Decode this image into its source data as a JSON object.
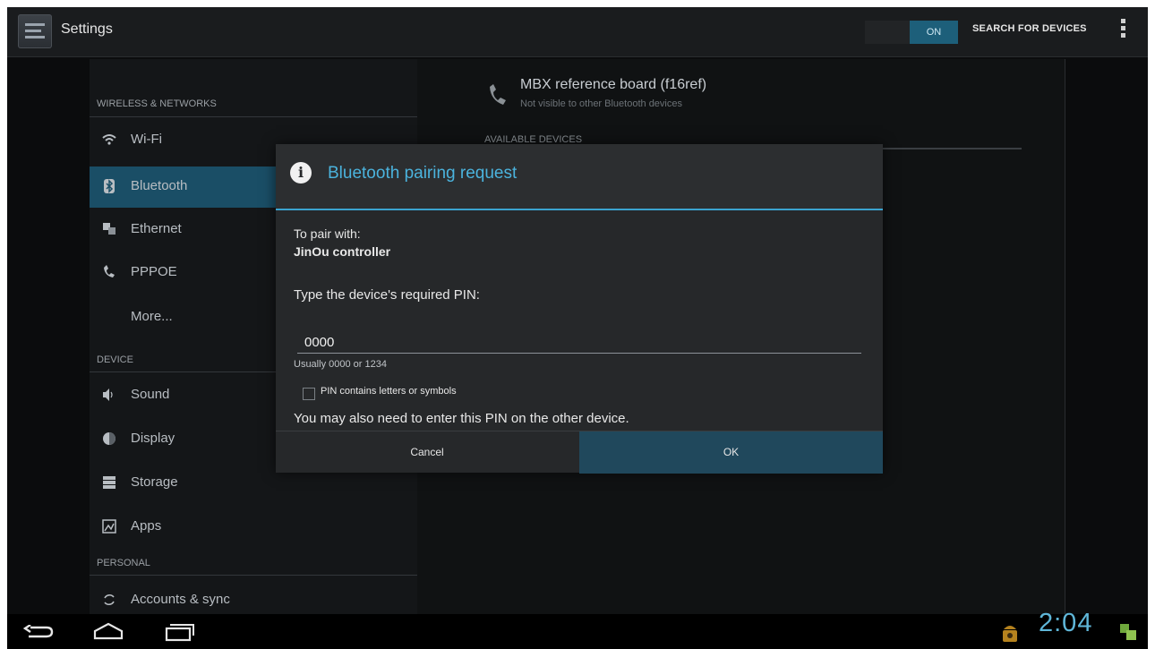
{
  "action_bar": {
    "title": "Settings",
    "toggle_state": "ON",
    "search_label": "SEARCH FOR DEVICES"
  },
  "sidebar": {
    "sections": {
      "wireless": "WIRELESS & NETWORKS",
      "device": "DEVICE",
      "personal": "PERSONAL"
    },
    "items": [
      {
        "label": "Wi-Fi",
        "icon": "wifi-icon"
      },
      {
        "label": "Bluetooth",
        "icon": "bluetooth-icon",
        "selected": true
      },
      {
        "label": "Ethernet",
        "icon": "ethernet-icon"
      },
      {
        "label": "PPPOE",
        "icon": "pppoe-icon"
      },
      {
        "label": "More..."
      },
      {
        "label": "Sound",
        "icon": "sound-icon"
      },
      {
        "label": "Display",
        "icon": "display-icon"
      },
      {
        "label": "Storage",
        "icon": "storage-icon"
      },
      {
        "label": "Apps",
        "icon": "apps-icon"
      },
      {
        "label": "Accounts & sync",
        "icon": "sync-icon"
      }
    ]
  },
  "detail": {
    "device_name": "MBX reference board (f16ref)",
    "device_status": "Not visible to other Bluetooth devices",
    "available_header": "AVAILABLE DEVICES"
  },
  "dialog": {
    "title": "Bluetooth pairing request",
    "pair_with_label": "To pair with:",
    "device": "JinOu controller",
    "prompt": "Type the device's required PIN:",
    "pin_value": "0000",
    "hint": "Usually 0000 or 1234",
    "checkbox_label": "PIN contains letters or symbols",
    "note": "You may also need to enter this PIN on the other device.",
    "cancel_label": "Cancel",
    "ok_label": "OK"
  },
  "status_bar": {
    "time": "2:04"
  },
  "colors": {
    "accent": "#3ba3cf",
    "selected": "#1a4e66"
  }
}
